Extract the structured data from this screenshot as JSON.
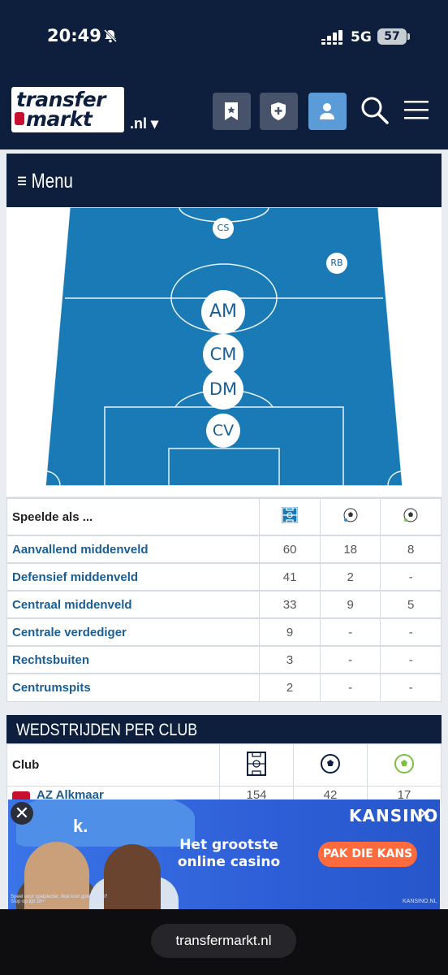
{
  "status_bar": {
    "time": "20:49",
    "network": "5G",
    "battery": "57"
  },
  "header": {
    "logo_line1": "transfer",
    "logo_line2": "markt",
    "tld": ".nl ▾"
  },
  "menu": {
    "label": "≡ Menu"
  },
  "pitch": {
    "positions": [
      "CS",
      "RB",
      "AM",
      "CM",
      "DM",
      "CV"
    ]
  },
  "positions_table": {
    "header": "Speelde als ...",
    "rows": [
      {
        "name": "Aanvallend middenveld",
        "apps": "60",
        "goals": "18",
        "assists": "8"
      },
      {
        "name": "Defensief middenveld",
        "apps": "41",
        "goals": "2",
        "assists": "-"
      },
      {
        "name": "Centraal middenveld",
        "apps": "33",
        "goals": "9",
        "assists": "5"
      },
      {
        "name": "Centrale verdediger",
        "apps": "9",
        "goals": "-",
        "assists": "-"
      },
      {
        "name": "Rechtsbuiten",
        "apps": "3",
        "goals": "-",
        "assists": "-"
      },
      {
        "name": "Centrumspits",
        "apps": "2",
        "goals": "-",
        "assists": "-"
      }
    ]
  },
  "club_section": {
    "title": "WEDSTRIJDEN PER CLUB",
    "col_club": "Club",
    "rows": [
      {
        "club": "AZ Alkmaar",
        "apps": "154",
        "goals": "42",
        "assists": "17"
      }
    ]
  },
  "ad": {
    "brand": "KANSINO",
    "headline_1": "Het grootste",
    "headline_2": "online casino",
    "cta": "PAK DIE KANS",
    "logo_letter": "k.",
    "fine_print": "Speel voor spelplezier. Wat kost gokken jou? Stop op tijd 18+",
    "url": "KANSINO.NL",
    "close": "✕"
  },
  "browser": {
    "url": "transfermarkt.nl"
  }
}
